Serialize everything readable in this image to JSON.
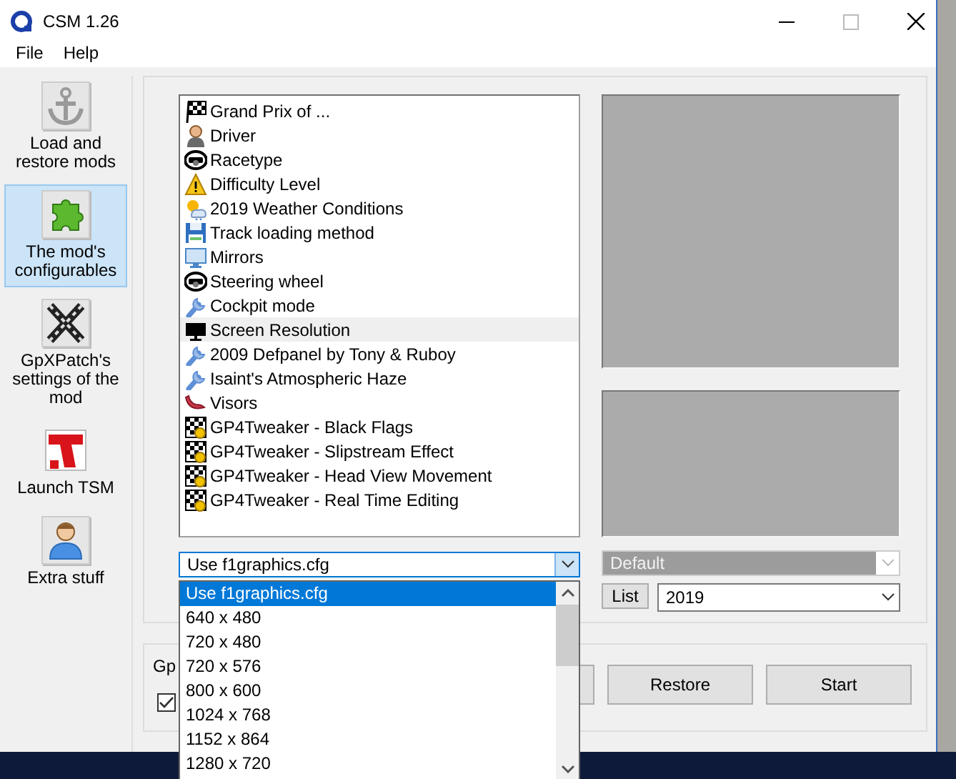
{
  "window": {
    "title": "CSM 1.26"
  },
  "menu": [
    "File",
    "Help"
  ],
  "sidebar": {
    "items": [
      {
        "label": "Load and restore mods",
        "kind": "anchor",
        "selected": false
      },
      {
        "label": "The mod's configurables",
        "kind": "puzzle",
        "selected": true
      },
      {
        "label": "GpXPatch's settings of the mod",
        "kind": "cross",
        "selected": false
      },
      {
        "label": "Launch TSM",
        "kind": "tsm",
        "selected": false
      },
      {
        "label": "Extra stuff",
        "kind": "person",
        "selected": false
      }
    ]
  },
  "mods": {
    "items": [
      {
        "label": "Grand Prix of ...",
        "kind": "flag",
        "selected": false
      },
      {
        "label": "Driver",
        "kind": "person",
        "selected": false
      },
      {
        "label": "Racetype",
        "kind": "wheel",
        "selected": false
      },
      {
        "label": "Difficulty Level",
        "kind": "warning",
        "selected": false
      },
      {
        "label": "2019 Weather Conditions",
        "kind": "weather",
        "selected": false
      },
      {
        "label": "Track loading method",
        "kind": "disk",
        "selected": false
      },
      {
        "label": "Mirrors",
        "kind": "screen",
        "selected": false
      },
      {
        "label": "Steering wheel",
        "kind": "wheel",
        "selected": false
      },
      {
        "label": "Cockpit mode",
        "kind": "wrench",
        "selected": false
      },
      {
        "label": "Screen Resolution",
        "kind": "monitor",
        "selected": true
      },
      {
        "label": "2009 Defpanel by Tony & Ruboy",
        "kind": "wrench",
        "selected": false
      },
      {
        "label": "Isaint's Atmospheric Haze",
        "kind": "wrench",
        "selected": false
      },
      {
        "label": "Visors",
        "kind": "visor",
        "selected": false
      },
      {
        "label": "GP4Tweaker - Black Flags",
        "kind": "checkered",
        "selected": false
      },
      {
        "label": "GP4Tweaker - Slipstream Effect",
        "kind": "checkered",
        "selected": false
      },
      {
        "label": "GP4Tweaker - Head View Movement",
        "kind": "checkered",
        "selected": false
      },
      {
        "label": "GP4Tweaker - Real Time Editing",
        "kind": "checkered",
        "selected": false
      }
    ]
  },
  "resolution_combo": {
    "value": "Use f1graphics.cfg",
    "expanded": true,
    "options": [
      {
        "label": "Use f1graphics.cfg",
        "selected": true
      },
      {
        "label": "640 x 480",
        "selected": false
      },
      {
        "label": "720 x 480",
        "selected": false
      },
      {
        "label": "720 x 576",
        "selected": false
      },
      {
        "label": "800 x 600",
        "selected": false
      },
      {
        "label": "1024 x 768",
        "selected": false
      },
      {
        "label": "1152 x 864",
        "selected": false
      },
      {
        "label": "1280 x 720",
        "selected": false
      }
    ]
  },
  "preset_combo": {
    "value": "Default",
    "disabled": true
  },
  "list_button": "List",
  "season_combo": {
    "value": "2019",
    "disabled": false
  },
  "bottom": {
    "label": "Gp",
    "checkbox": {
      "checked": true
    },
    "buttons": [
      "Restore",
      "Start"
    ]
  }
}
